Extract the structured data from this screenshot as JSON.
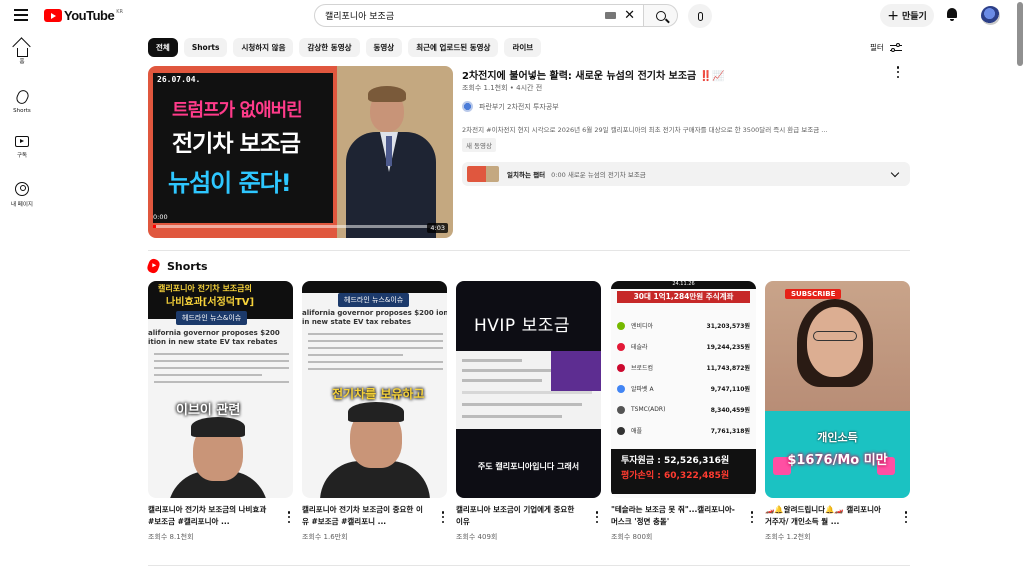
{
  "header": {
    "logo_text": "YouTube",
    "logo_country": "KR",
    "search_value": "캘리포니아 보조금",
    "create_label": "만들기"
  },
  "sidebar": {
    "items": [
      {
        "label": "홈",
        "icon": "home-icon"
      },
      {
        "label": "Shorts",
        "icon": "shorts-icon"
      },
      {
        "label": "구독",
        "icon": "subscriptions-icon"
      },
      {
        "label": "내 페이지",
        "icon": "you-icon"
      }
    ]
  },
  "chips": [
    "전체",
    "Shorts",
    "시청하지 않음",
    "감상한 동영상",
    "동영상",
    "최근에 업로드된 동영상",
    "라이브"
  ],
  "filter_label": "필터",
  "video": {
    "title": "2차전지에 불어넣는 활력: 새로운 뉴섬의 전기차 보조금",
    "title_emoji": "‼️📈",
    "meta": "조회수 1.1천회 • 4시간 전",
    "channel": "파란부기 2차전지 투자공부",
    "description": "2차전지 #이차전지 현지 시각으로 2026년 6월 29일 캘리포니아의 최초 전기차 구매자를 대상으로 한 3500달러 즉시 환급 보조금 ...",
    "badge": "새 동영상",
    "thumb": {
      "date": "26.07.04.",
      "line1": "트럼프가 없애버린",
      "line2": "전기차 보조금",
      "line3": "뉴섬이 준다!",
      "time": "0:00",
      "duration": "4:03",
      "progress": 0.01
    },
    "chapter": {
      "label": "일치하는 챕터",
      "text": "0:00 새로운 뉴섬의 전기차 보조금"
    }
  },
  "shorts_section": {
    "title": "Shorts",
    "items": [
      {
        "title": "캘리포니아 전기차 보조금의 나비효과 #보조금 #캘리포니아 ...",
        "views": "조회수 8.1천회",
        "thumb_top": "캘리포니아 전기차 보조금의",
        "thumb_sub": "나비효과[서정덕TV]",
        "thumb_tag": "헤드라인 뉴스&이슈",
        "thumb_en": "alifornia governor proposes $200 ition in new state EV tax rebates",
        "thumb_caption": "이브이 관련"
      },
      {
        "title": "캘리포니아 전기차 보조금이 중요한 이유 #보조금 #캘리포니 ...",
        "views": "조회수 1.6만회",
        "thumb_tag": "헤드라인 뉴스&이슈",
        "thumb_en": "alifornia governor proposes $200 ion in new state EV tax rebates",
        "thumb_caption": "전기차를 보유하고"
      },
      {
        "title": "캘리포니아 보조금이 기업에게 중요한 이유",
        "views": "조회수 409회",
        "thumb_title": "HVIP 보조금",
        "thumb_caption": "주도 캘리포니아입니다 그래서"
      },
      {
        "title": "\"테슬라는 보조금 못 줘\"...캘리포니아-머스크 '정면 충돌'",
        "views": "조회수 800회",
        "thumb_date": "24.11.26",
        "thumb_head": "30대 1억1,284만원 주식계좌",
        "rows": [
          {
            "name": "엔비디아",
            "value": "31,203,573원",
            "color": "#76b900"
          },
          {
            "name": "테슬라",
            "value": "19,244,235원",
            "color": "#e31937"
          },
          {
            "name": "브로드컴",
            "value": "11,743,872원",
            "color": "#cc092f"
          },
          {
            "name": "알파벳 A",
            "value": "9,747,110원",
            "color": "#4285f4"
          },
          {
            "name": "TSMC(ADR)",
            "value": "8,340,459원",
            "color": "#555555"
          },
          {
            "name": "애플",
            "value": "7,761,318원",
            "color": "#333333"
          }
        ],
        "thumb_l1": "투자원금 : 52,526,316원",
        "thumb_l2": "평가손익 : 60,322,485원"
      },
      {
        "title": "🏎️🔔알려드립니다🔔🏎️ 캘리포니아 거주자/ 개인소득 월 ...",
        "views": "조회수 1.2천회",
        "thumb_sub": "SUBSCRIBE",
        "thumb_l1": "개인소득",
        "thumb_l2": "$1676/Mo 미만"
      }
    ]
  },
  "colors": {
    "brand_red": "#ff0000",
    "chip_active_bg": "#0f0f0f",
    "chip_bg": "#f2f2f2",
    "meta_text": "#606060"
  }
}
